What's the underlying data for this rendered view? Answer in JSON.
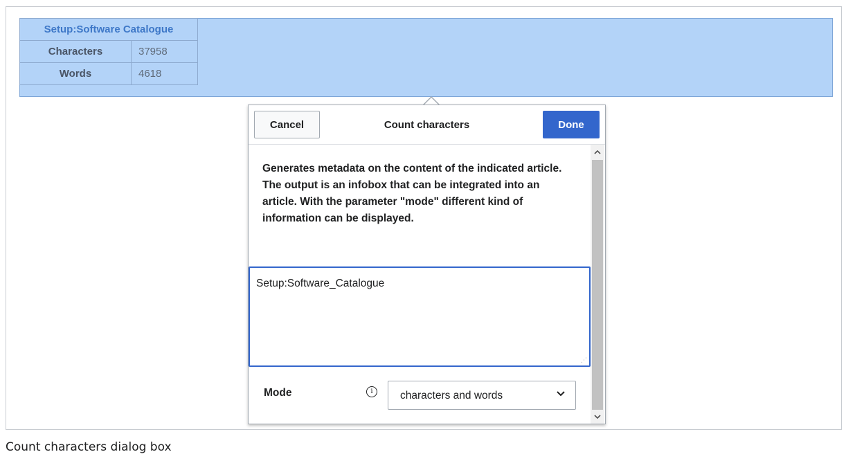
{
  "infobox": {
    "title": "Setup:Software Catalogue",
    "rows": [
      {
        "label": "Characters",
        "value": "37958"
      },
      {
        "label": "Words",
        "value": "4618"
      }
    ]
  },
  "dialog": {
    "cancel_label": "Cancel",
    "title": "Count characters",
    "done_label": "Done",
    "description": "Generates metadata on the content of the indicated article. The output is an infobox that can be integrated into an article. With the parameter \"mode\" different kind of information can be displayed.",
    "article_value": "Setup:Software_Catalogue",
    "mode_label": "Mode",
    "mode_value": "characters and words",
    "info_icon": "i"
  },
  "caption": "Count characters dialog box",
  "colors": {
    "accent": "#3366cc",
    "highlight": "#b3d3f8",
    "infobox_title": "#3e78c8"
  },
  "icons": [
    "info-icon",
    "chevron-down-icon",
    "scroll-up-icon",
    "scroll-down-icon",
    "resize-grip-icon"
  ]
}
